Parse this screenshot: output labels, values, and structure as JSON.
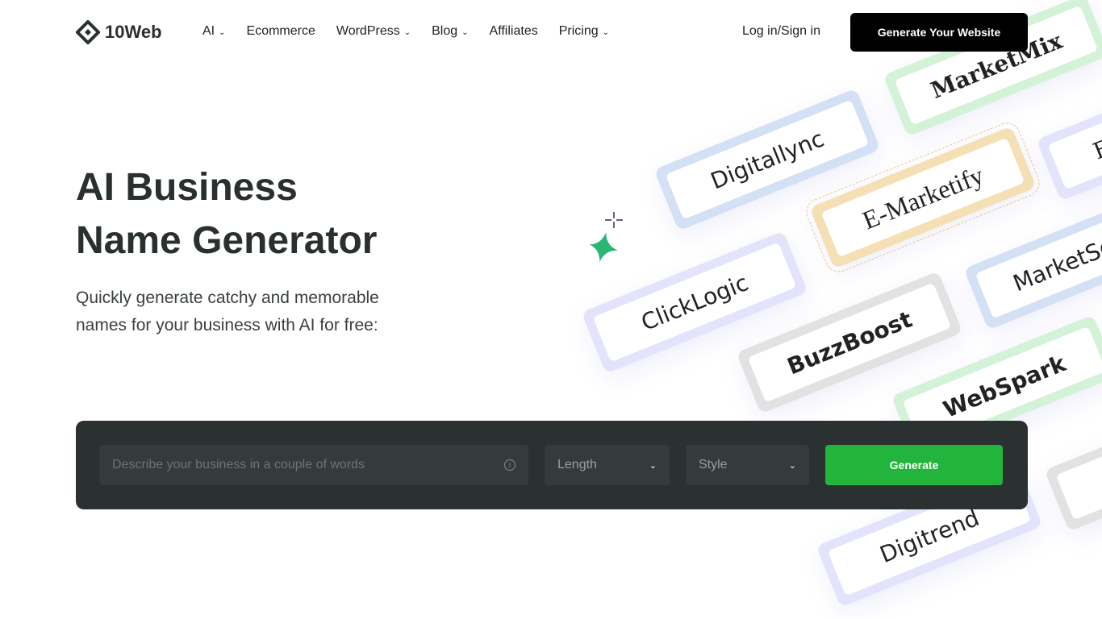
{
  "nav": {
    "logo": "10Web",
    "items": [
      {
        "label": "AI",
        "dropdown": true
      },
      {
        "label": "Ecommerce",
        "dropdown": false
      },
      {
        "label": "WordPress",
        "dropdown": true
      },
      {
        "label": "Blog",
        "dropdown": true
      },
      {
        "label": "Affiliates",
        "dropdown": false
      },
      {
        "label": "Pricing",
        "dropdown": true
      }
    ],
    "login": "Log in/Sign in",
    "cta": "Generate Your Website"
  },
  "hero": {
    "title_line1": "AI Business",
    "title_line2": "Name Generator",
    "subtitle": "Quickly generate catchy and memorable names for your business with AI for free:"
  },
  "form": {
    "placeholder": "Describe your business in a couple of words",
    "length_label": "Length",
    "style_label": "Style",
    "generate_label": "Generate"
  },
  "cards": [
    "MarketMix",
    "Digitallync",
    "E-Marketify",
    "ClickLogic",
    "BuzzBoost",
    "MarketSc",
    "WebSpark",
    "Digitrend",
    "E"
  ],
  "colors": {
    "accent": "#22b43c",
    "dark": "#2b3031",
    "cta": "#000000"
  }
}
